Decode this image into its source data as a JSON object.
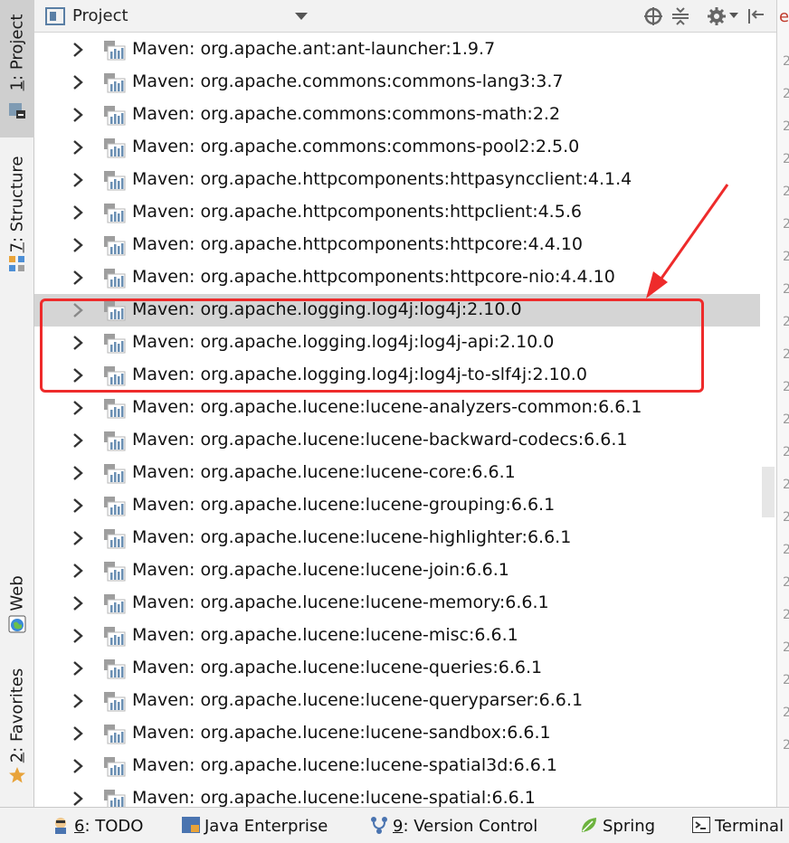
{
  "left_strip": {
    "tabs": [
      {
        "num": "1",
        "label": ": Project"
      },
      {
        "num": "7",
        "label": ": Structure"
      },
      {
        "num": "",
        "label": "Web"
      },
      {
        "num": "2",
        "label": ": Favorites"
      }
    ]
  },
  "header": {
    "title": "Project",
    "icons": [
      "project-view-icon",
      "dropdown-icon",
      "locate-icon",
      "collapse-icon",
      "gear-icon",
      "hide-icon"
    ]
  },
  "editor": {
    "tab_char": "e",
    "line_char": "2"
  },
  "tree": {
    "items": [
      {
        "label": "Maven: org.apache.ant:ant-launcher:1.9.7"
      },
      {
        "label": "Maven: org.apache.commons:commons-lang3:3.7"
      },
      {
        "label": "Maven: org.apache.commons:commons-math:2.2"
      },
      {
        "label": "Maven: org.apache.commons:commons-pool2:2.5.0"
      },
      {
        "label": "Maven: org.apache.httpcomponents:httpasyncclient:4.1.4"
      },
      {
        "label": "Maven: org.apache.httpcomponents:httpclient:4.5.6"
      },
      {
        "label": "Maven: org.apache.httpcomponents:httpcore:4.4.10"
      },
      {
        "label": "Maven: org.apache.httpcomponents:httpcore-nio:4.4.10"
      },
      {
        "label": "Maven: org.apache.logging.log4j:log4j:2.10.0",
        "selected": true
      },
      {
        "label": "Maven: org.apache.logging.log4j:log4j-api:2.10.0"
      },
      {
        "label": "Maven: org.apache.logging.log4j:log4j-to-slf4j:2.10.0"
      },
      {
        "label": "Maven: org.apache.lucene:lucene-analyzers-common:6.6.1"
      },
      {
        "label": "Maven: org.apache.lucene:lucene-backward-codecs:6.6.1"
      },
      {
        "label": "Maven: org.apache.lucene:lucene-core:6.6.1"
      },
      {
        "label": "Maven: org.apache.lucene:lucene-grouping:6.6.1"
      },
      {
        "label": "Maven: org.apache.lucene:lucene-highlighter:6.6.1"
      },
      {
        "label": "Maven: org.apache.lucene:lucene-join:6.6.1"
      },
      {
        "label": "Maven: org.apache.lucene:lucene-memory:6.6.1"
      },
      {
        "label": "Maven: org.apache.lucene:lucene-misc:6.6.1"
      },
      {
        "label": "Maven: org.apache.lucene:lucene-queries:6.6.1"
      },
      {
        "label": "Maven: org.apache.lucene:lucene-queryparser:6.6.1"
      },
      {
        "label": "Maven: org.apache.lucene:lucene-sandbox:6.6.1"
      },
      {
        "label": "Maven: org.apache.lucene:lucene-spatial3d:6.6.1"
      },
      {
        "label": "Maven: org.apache.lucene:lucene-spatial:6.6.1"
      }
    ]
  },
  "bottom_bar": {
    "todo_num": "6",
    "todo_label": ": TODO",
    "java_enterprise": "Java Enterprise",
    "vc_num": "9",
    "vc_label": ": Version Control",
    "spring": "Spring",
    "terminal": "Terminal"
  },
  "colors": {
    "highlight": "#ee2b2b",
    "selected_row": "#d5d5d5",
    "panel_bg": "#f2f2f2"
  }
}
